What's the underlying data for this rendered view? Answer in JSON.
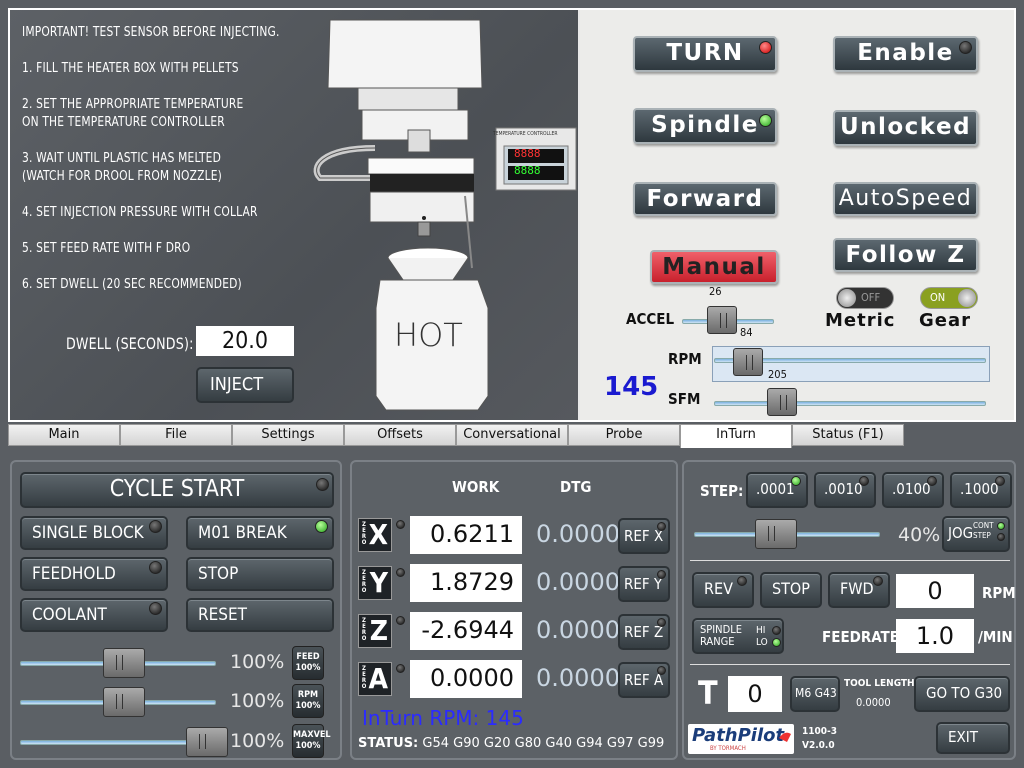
{
  "instructions": {
    "l1": "IMPORTANT! TEST SENSOR BEFORE INJECTING.",
    "l2": "1. FILL THE HEATER BOX WITH PELLETS",
    "l3a": "2. SET THE APPROPRIATE TEMPERATURE",
    "l3b": "ON THE TEMPERATURE CONTROLLER",
    "l4a": "3. WAIT UNTIL PLASTIC HAS MELTED",
    "l4b": "(WATCH FOR DROOL FROM NOZZLE)",
    "l5": "4. SET INJECTION PRESSURE WITH COLLAR",
    "l6": "5. SET FEED RATE WITH F DRO",
    "l7": "6. SET DWELL (20 SEC RECOMMENDED)",
    "dwell_label": "DWELL (SECONDS):",
    "dwell_value": "20.0",
    "inject": "INJECT",
    "hot": "HOT",
    "controller_label": "TEMPERATURE CONTROLLER",
    "pv": "8888",
    "sv": "8888"
  },
  "lathe": {
    "turn": "TURN",
    "enable": "Enable",
    "spindle": "Spindle",
    "unlocked": "Unlocked",
    "forward": "Forward",
    "autospeed": "AutoSpeed",
    "manual": "Manual",
    "followz": "Follow Z",
    "off": "OFF",
    "on": "ON",
    "metric": "Metric",
    "gear": "Gear",
    "accel_label": "ACCEL",
    "accel_top": "26",
    "accel_bottom": "84",
    "rpm_label": "RPM",
    "rpm_val": "205",
    "sfm_label": "SFM",
    "big_value": "145",
    "accel_level": 0.4,
    "rpm_level": 0.08,
    "sfm_level": 0.22
  },
  "tabs": [
    "Main",
    "File",
    "Settings",
    "Offsets",
    "Conversational",
    "Probe",
    "InTurn",
    "Status (F1)"
  ],
  "cycle": {
    "cycle_start": "CYCLE START",
    "single_block": "SINGLE BLOCK",
    "m01": "M01 BREAK",
    "feedhold": "FEEDHOLD",
    "stop": "STOP",
    "coolant": "COOLANT",
    "reset": "RESET",
    "feed_pct": "100%",
    "rpm_pct": "100%",
    "maxvel_pct": "100%",
    "feed_btn": "FEED 100%",
    "rpm_btn": "RPM 100%",
    "maxvel_btn": "MAXVEL 100%",
    "feed_level": 0.5,
    "rpm_level": 0.5,
    "maxvel_level": 1.0
  },
  "dro": {
    "work": "WORK",
    "dtg": "DTG",
    "zero": "ZERO",
    "x": "X",
    "y": "Y",
    "z": "Z",
    "a": "A",
    "x_val": "0.6211",
    "y_val": "1.8729",
    "z_val": "-2.6944",
    "a_val": "0.0000",
    "x_dtg": "0.0000",
    "y_dtg": "0.0000",
    "z_dtg": "0.0000",
    "a_dtg": "0.0000",
    "ref_x": "REF X",
    "ref_y": "REF Y",
    "ref_z": "REF Z",
    "ref_a": "REF A",
    "inturn_rpm": "InTurn RPM: 145",
    "status_label": "STATUS:",
    "status": "G54 G90 G20 G80 G40 G94 G97 G99"
  },
  "jog": {
    "step_label": "STEP:",
    "s1": ".0001",
    "s2": ".0010",
    "s3": ".0100",
    "s4": ".1000",
    "jog_pct": "40%",
    "jog": "JOG",
    "cont": "CONT",
    "step": "STEP",
    "jog_level": 0.4,
    "rev": "REV",
    "stop": "STOP",
    "fwd": "FWD",
    "rpm_value": "0",
    "rpm_unit": "RPM",
    "spindle_range": "SPINDLE RANGE",
    "hi": "HI",
    "lo": "LO",
    "feedrate_label": "FEEDRATE:",
    "feedrate_value": "1.0",
    "feedrate_unit": "/MIN",
    "t": "T",
    "tool": "0",
    "m6g43": "M6 G43",
    "tool_length_label": "TOOL LENGTH",
    "tool_length": "0.0000",
    "g30": "GO TO G30",
    "logo": "PathPilot",
    "logo_sub": "BY TORMACH",
    "model": "1100-3",
    "version": "V2.0.0",
    "exit": "EXIT"
  }
}
